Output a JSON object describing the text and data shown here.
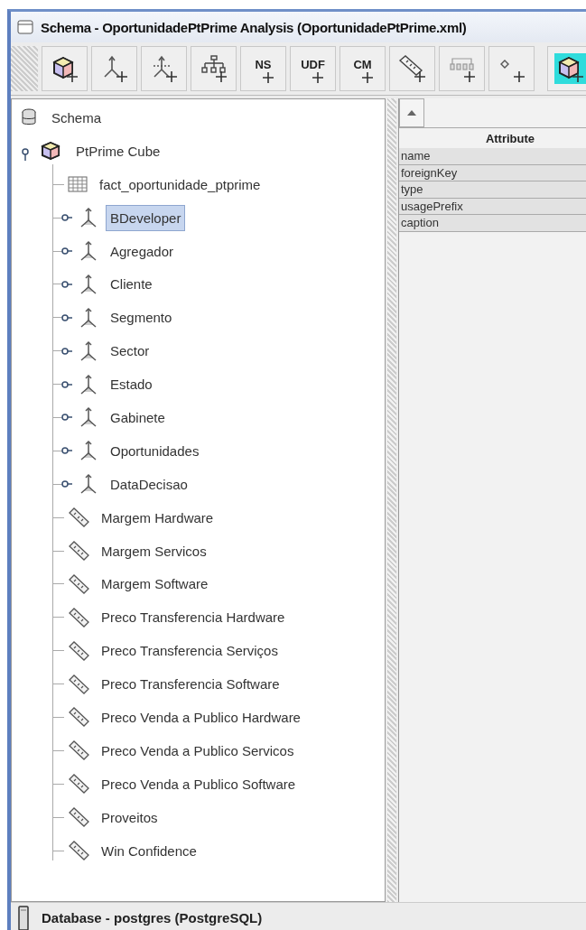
{
  "window": {
    "title": "Schema - OportunidadePtPrime Analysis (OportunidadePtPrime.xml)"
  },
  "toolbar": [
    {
      "kind": "cube",
      "selected": false
    },
    {
      "kind": "dimension",
      "selected": false
    },
    {
      "kind": "dimension-usage",
      "selected": false
    },
    {
      "kind": "hierarchy",
      "selected": false
    },
    {
      "kind": "text",
      "label": "NS",
      "selected": false
    },
    {
      "kind": "text",
      "label": "UDF",
      "selected": false
    },
    {
      "kind": "text",
      "label": "CM",
      "selected": false
    },
    {
      "kind": "measure",
      "selected": false
    },
    {
      "kind": "level",
      "selected": false
    },
    {
      "kind": "property",
      "selected": false
    },
    {
      "kind": "cube",
      "selected": true
    }
  ],
  "tree": {
    "label": "Schema",
    "selected": false,
    "children": [
      {
        "label": "PtPrime Cube",
        "selected": false,
        "expanded": true,
        "children": [
          {
            "label": "fact_oportunidade_ptprime",
            "kind": "table",
            "selected": false
          },
          {
            "label": "BDeveloper",
            "kind": "dimension",
            "selected": true,
            "expanded": false
          },
          {
            "label": "Agregador",
            "kind": "dimension",
            "selected": false,
            "expanded": false
          },
          {
            "label": "Cliente",
            "kind": "dimension",
            "selected": false,
            "expanded": false
          },
          {
            "label": "Segmento",
            "kind": "dimension",
            "selected": false,
            "expanded": false
          },
          {
            "label": "Sector",
            "kind": "dimension",
            "selected": false,
            "expanded": false
          },
          {
            "label": "Estado",
            "kind": "dimension",
            "selected": false,
            "expanded": false
          },
          {
            "label": "Gabinete",
            "kind": "dimension",
            "selected": false,
            "expanded": false
          },
          {
            "label": "Oportunidades",
            "kind": "dimension",
            "selected": false,
            "expanded": false
          },
          {
            "label": "DataDecisao",
            "kind": "dimension",
            "selected": false,
            "expanded": false
          },
          {
            "label": "Margem Hardware",
            "kind": "measure",
            "selected": false
          },
          {
            "label": "Margem Servicos",
            "kind": "measure",
            "selected": false
          },
          {
            "label": "Margem Software",
            "kind": "measure",
            "selected": false
          },
          {
            "label": "Preco Transferencia Hardware",
            "kind": "measure",
            "selected": false
          },
          {
            "label": "Preco Transferencia Serviços",
            "kind": "measure",
            "selected": false
          },
          {
            "label": "Preco Transferencia Software",
            "kind": "measure",
            "selected": false
          },
          {
            "label": "Preco Venda a Publico Hardware",
            "kind": "measure",
            "selected": false
          },
          {
            "label": "Preco Venda a Publico Servicos",
            "kind": "measure",
            "selected": false
          },
          {
            "label": "Preco Venda a Publico Software",
            "kind": "measure",
            "selected": false
          },
          {
            "label": "Proveitos",
            "kind": "measure",
            "selected": false
          },
          {
            "label": "Win Confidence",
            "kind": "measure",
            "selected": false
          }
        ]
      }
    ]
  },
  "attributes": {
    "column": "Attribute",
    "rows": [
      "name",
      "foreignKey",
      "type",
      "usagePrefix",
      "caption"
    ]
  },
  "status_bar": {
    "text": "Database - postgres (PostgreSQL)"
  }
}
